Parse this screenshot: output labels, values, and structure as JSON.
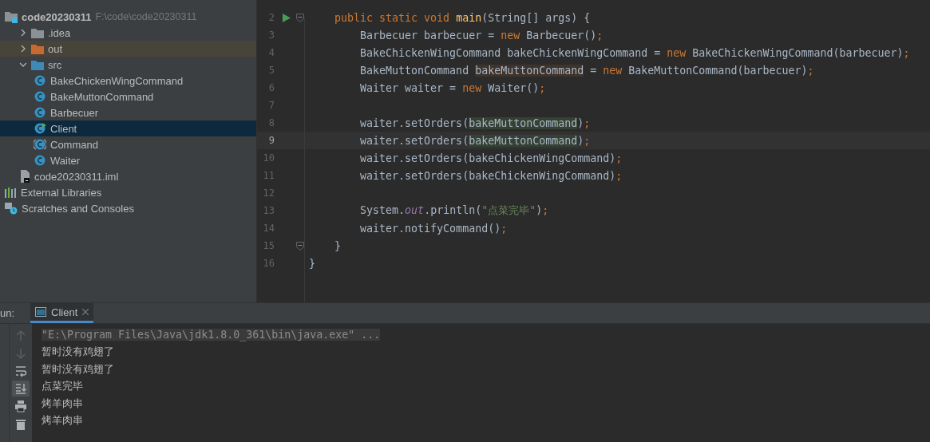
{
  "project_tree": [
    {
      "label": "code20230311",
      "path": "F:\\code\\code20230311",
      "kind": "module",
      "selected": false,
      "excluded": false,
      "children": [
        {
          "label": ".idea",
          "kind": "folder",
          "expanded": false,
          "selected": false,
          "excluded": false
        },
        {
          "label": "out",
          "kind": "folder",
          "expanded": false,
          "selected": false,
          "excluded": true
        },
        {
          "label": "src",
          "kind": "folder",
          "expanded": true,
          "selected": false,
          "excluded": false,
          "children": [
            {
              "label": "BakeChickenWingCommand",
              "kind": "class",
              "selected": false,
              "excluded": false
            },
            {
              "label": "BakeMuttonCommand",
              "kind": "class",
              "selected": false,
              "excluded": false
            },
            {
              "label": "Barbecuer",
              "kind": "class",
              "selected": false,
              "excluded": false
            },
            {
              "label": "Client",
              "kind": "main-class",
              "selected": true,
              "excluded": false
            },
            {
              "label": "Command",
              "kind": "abstract-class",
              "selected": false,
              "excluded": false
            },
            {
              "label": "Waiter",
              "kind": "class",
              "selected": false,
              "excluded": false
            }
          ]
        },
        {
          "label": "code20230311.iml",
          "kind": "file",
          "selected": false,
          "excluded": false
        }
      ]
    },
    {
      "label": "External Libraries",
      "kind": "libraries",
      "selected": false,
      "excluded": false
    },
    {
      "label": "Scratches and Consoles",
      "kind": "scratches",
      "selected": false,
      "excluded": false
    }
  ],
  "editor": {
    "lines": [
      {
        "number": "2",
        "current": false,
        "gutter_marks": [
          {
            "kind": "run"
          },
          {
            "kind": "fold"
          }
        ],
        "tokens": [
          {
            "t": "    public static void ",
            "kind": "keyword"
          },
          {
            "t": "main",
            "kind": "method"
          },
          {
            "t": "(String[] args) {",
            "kind": "plain"
          }
        ]
      },
      {
        "number": "3",
        "current": false,
        "tokens": [
          {
            "t": "        Barbecuer barbecuer = ",
            "kind": "plain"
          },
          {
            "t": "new ",
            "kind": "keyword"
          },
          {
            "t": "Barbecuer()",
            "kind": "plain"
          },
          {
            "t": ";",
            "kind": "keyword"
          }
        ]
      },
      {
        "number": "4",
        "current": false,
        "tokens": [
          {
            "t": "        BakeChickenWingCommand bakeChickenWingCommand = ",
            "kind": "plain"
          },
          {
            "t": "new ",
            "kind": "keyword"
          },
          {
            "t": "BakeChickenWingCommand(barbecuer)",
            "kind": "plain"
          },
          {
            "t": ";",
            "kind": "keyword"
          }
        ]
      },
      {
        "number": "5",
        "current": false,
        "tokens": [
          {
            "t": "        BakeMuttonCommand ",
            "kind": "plain"
          },
          {
            "t": "bakeMuttonCommand",
            "kind": "write-usage"
          },
          {
            "t": " = ",
            "kind": "plain"
          },
          {
            "t": "new ",
            "kind": "keyword"
          },
          {
            "t": "BakeMuttonCommand(barbecuer)",
            "kind": "plain"
          },
          {
            "t": ";",
            "kind": "keyword"
          }
        ]
      },
      {
        "number": "6",
        "current": false,
        "tokens": [
          {
            "t": "        Waiter waiter = ",
            "kind": "plain"
          },
          {
            "t": "new ",
            "kind": "keyword"
          },
          {
            "t": "Waiter()",
            "kind": "plain"
          },
          {
            "t": ";",
            "kind": "keyword"
          }
        ]
      },
      {
        "number": "7",
        "current": false
      },
      {
        "number": "8",
        "current": false,
        "tokens": [
          {
            "t": "        waiter.setOrders(",
            "kind": "plain"
          },
          {
            "t": "bakeMuttonCommand",
            "kind": "read-usage"
          },
          {
            "t": ")",
            "kind": "plain"
          },
          {
            "t": ";",
            "kind": "keyword"
          }
        ]
      },
      {
        "number": "9",
        "current": true,
        "tokens": [
          {
            "t": "        waiter.setOrders(",
            "kind": "plain"
          },
          {
            "t": "bakeMuttonCommand",
            "kind": "read-usage"
          },
          {
            "t": ")",
            "kind": "plain"
          },
          {
            "t": ";",
            "kind": "keyword"
          }
        ]
      },
      {
        "number": "10",
        "current": false,
        "tokens": [
          {
            "t": "        waiter.setOrders(bakeChickenWingCommand)",
            "kind": "plain"
          },
          {
            "t": ";",
            "kind": "keyword"
          }
        ]
      },
      {
        "number": "11",
        "current": false,
        "tokens": [
          {
            "t": "        waiter.setOrders(bakeChickenWingCommand)",
            "kind": "plain"
          },
          {
            "t": ";",
            "kind": "keyword"
          }
        ]
      },
      {
        "number": "12",
        "current": false
      },
      {
        "number": "13",
        "current": false,
        "tokens": [
          {
            "t": "        System.",
            "kind": "plain"
          },
          {
            "t": "out",
            "kind": "static-field"
          },
          {
            "t": ".println(",
            "kind": "plain"
          },
          {
            "t": "\"点菜完毕\"",
            "kind": "string"
          },
          {
            "t": ")",
            "kind": "plain"
          },
          {
            "t": ";",
            "kind": "keyword"
          }
        ]
      },
      {
        "number": "14",
        "current": false,
        "tokens": [
          {
            "t": "        waiter.notifyCommand()",
            "kind": "plain"
          },
          {
            "t": ";",
            "kind": "keyword"
          }
        ]
      },
      {
        "number": "15",
        "current": false,
        "gutter_marks": [
          {
            "kind": "fold"
          }
        ],
        "tokens": [
          {
            "t": "    }",
            "kind": "plain"
          }
        ]
      },
      {
        "number": "16",
        "current": false,
        "tokens": [
          {
            "t": "}",
            "kind": "plain"
          }
        ]
      }
    ]
  },
  "run_panel": {
    "label": "un:",
    "tabs": [
      {
        "label": "Client",
        "selected": true
      }
    ],
    "toolbar": [
      {
        "kind": "up",
        "disabled": true,
        "on": false
      },
      {
        "kind": "down",
        "disabled": true,
        "on": false
      },
      {
        "kind": "wrap",
        "disabled": false,
        "on": false
      },
      {
        "kind": "scroll-end",
        "disabled": false,
        "on": true
      },
      {
        "kind": "print",
        "disabled": false,
        "on": false
      },
      {
        "kind": "trash",
        "disabled": false,
        "on": false
      }
    ],
    "console": [
      {
        "kind": "command",
        "text": "\"E:\\Program Files\\Java\\jdk1.8.0_361\\bin\\java.exe\" ..."
      },
      {
        "kind": "output",
        "text": "暂时没有鸡翅了"
      },
      {
        "kind": "output",
        "text": "暂时没有鸡翅了"
      },
      {
        "kind": "output",
        "text": "点菜完毕"
      },
      {
        "kind": "output",
        "text": "烤羊肉串"
      },
      {
        "kind": "output",
        "text": "烤羊肉串"
      }
    ]
  }
}
